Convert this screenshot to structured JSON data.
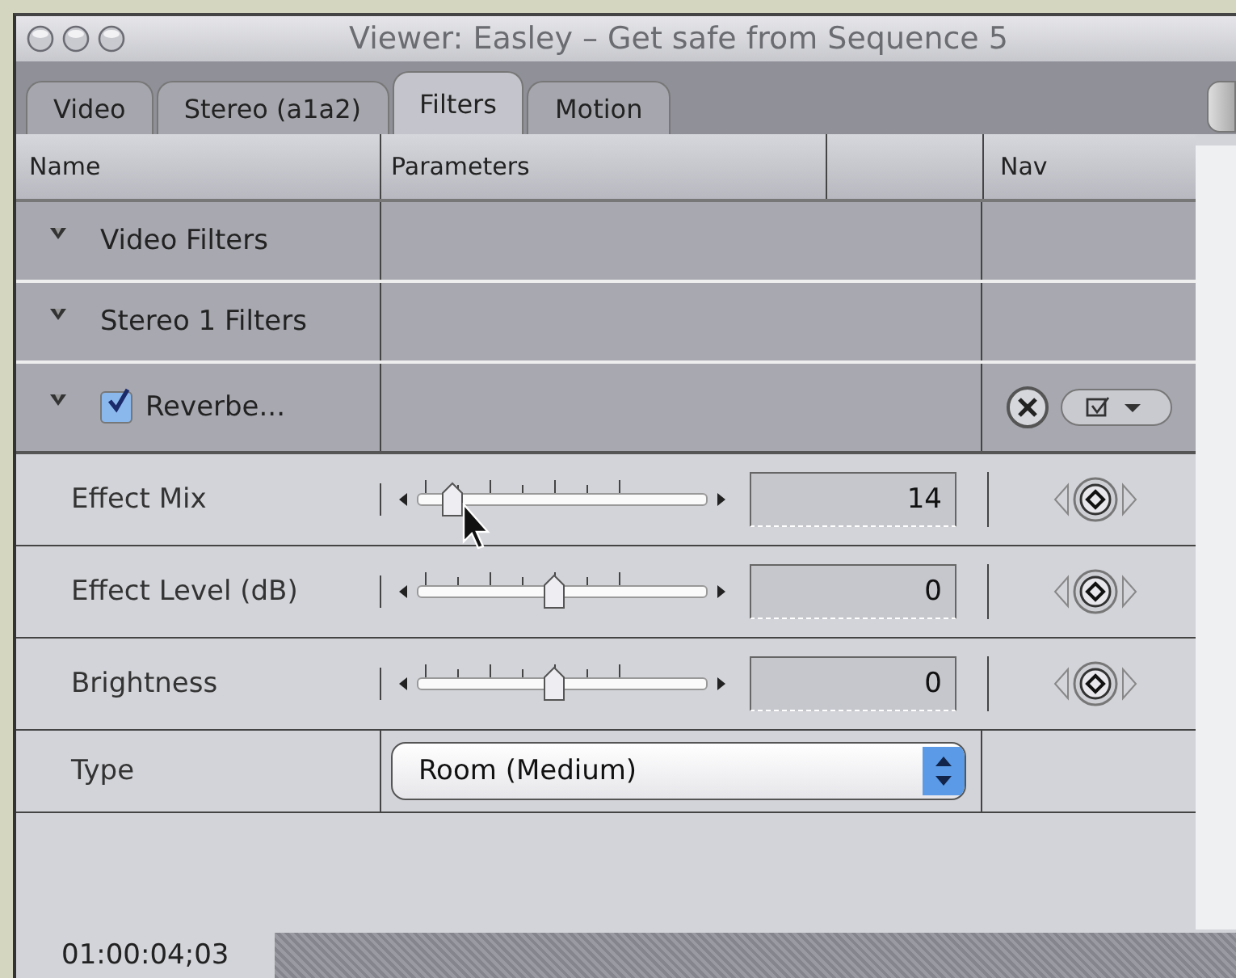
{
  "window": {
    "title": "Viewer: Easley – Get safe from Sequence 5"
  },
  "tabs": [
    {
      "label": "Video",
      "selected": false
    },
    {
      "label": "Stereo (a1a2)",
      "selected": false
    },
    {
      "label": "Filters",
      "selected": true
    },
    {
      "label": "Motion",
      "selected": false
    }
  ],
  "table": {
    "columns": [
      "Name",
      "Parameters",
      "Nav"
    ],
    "rows": [
      {
        "kind": "group",
        "name": "Video Filters",
        "expanded": true
      },
      {
        "kind": "group",
        "name": "Stereo 1 Filters",
        "expanded": true
      },
      {
        "kind": "filter",
        "name": "Reverbe...",
        "expanded": true,
        "checked": true
      },
      {
        "kind": "slider",
        "name": "Effect Mix",
        "level": 0.12,
        "value": "14"
      },
      {
        "kind": "slider",
        "name": "Effect Level (dB)",
        "level": 0.47,
        "value": "0"
      },
      {
        "kind": "slider",
        "name": "Brightness",
        "level": 0.47,
        "value": "0"
      },
      {
        "kind": "popup",
        "name": "Type",
        "value": "Room (Medium)"
      }
    ]
  },
  "status_bar": {
    "timecode": "01:00:04;03"
  }
}
